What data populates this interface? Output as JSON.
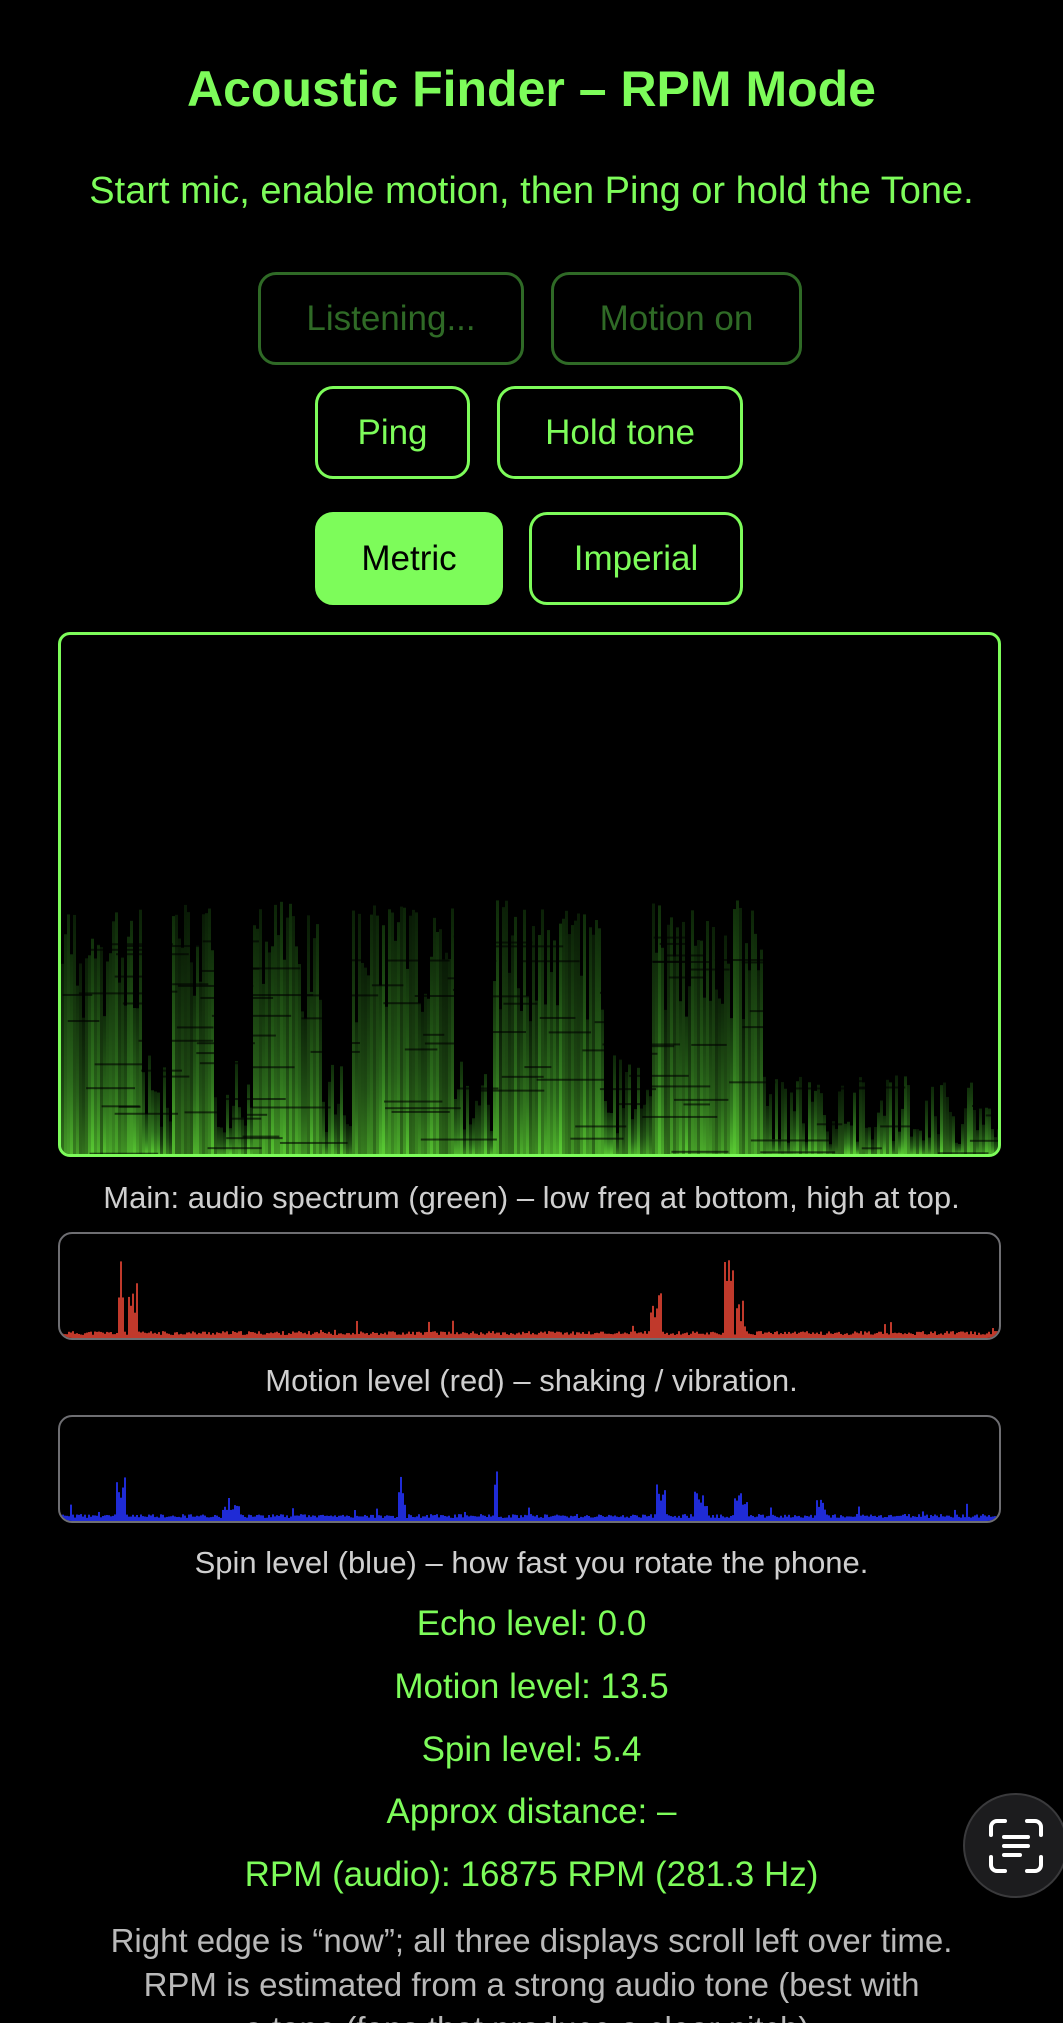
{
  "header": {
    "title": "Acoustic Finder – RPM Mode",
    "subtitle": "Start mic, enable motion, then Ping or hold the Tone."
  },
  "controls": {
    "listening_label": "Listening...",
    "motion_label": "Motion on",
    "ping_label": "Ping",
    "hold_tone_label": "Hold tone",
    "metric_label": "Metric",
    "imperial_label": "Imperial",
    "selected_unit": "Metric"
  },
  "captions": {
    "spectrum": "Main: audio spectrum (green) – low freq at bottom, high at top.",
    "motion": "Motion level (red) – shaking / vibration.",
    "spin": "Spin level (blue) – how fast you rotate the phone."
  },
  "readouts": {
    "echo": "Echo level: 0.0",
    "motion": "Motion level: 13.5",
    "spin": "Spin level: 5.4",
    "distance": "Approx distance: –",
    "rpm": "RPM (audio): 16875 RPM (281.3 Hz)"
  },
  "footer": {
    "line1": "Right edge is “now”; all three displays scroll left over time.",
    "line2": "RPM is estimated from a strong audio tone (best with",
    "line3": "a tone (fans that produce a clear pitch)."
  },
  "colors": {
    "accent": "#7dfc5a",
    "motion": "#c0392b",
    "spin": "#1f2bd6"
  },
  "icons": {
    "scan": "text-scan-icon"
  }
}
